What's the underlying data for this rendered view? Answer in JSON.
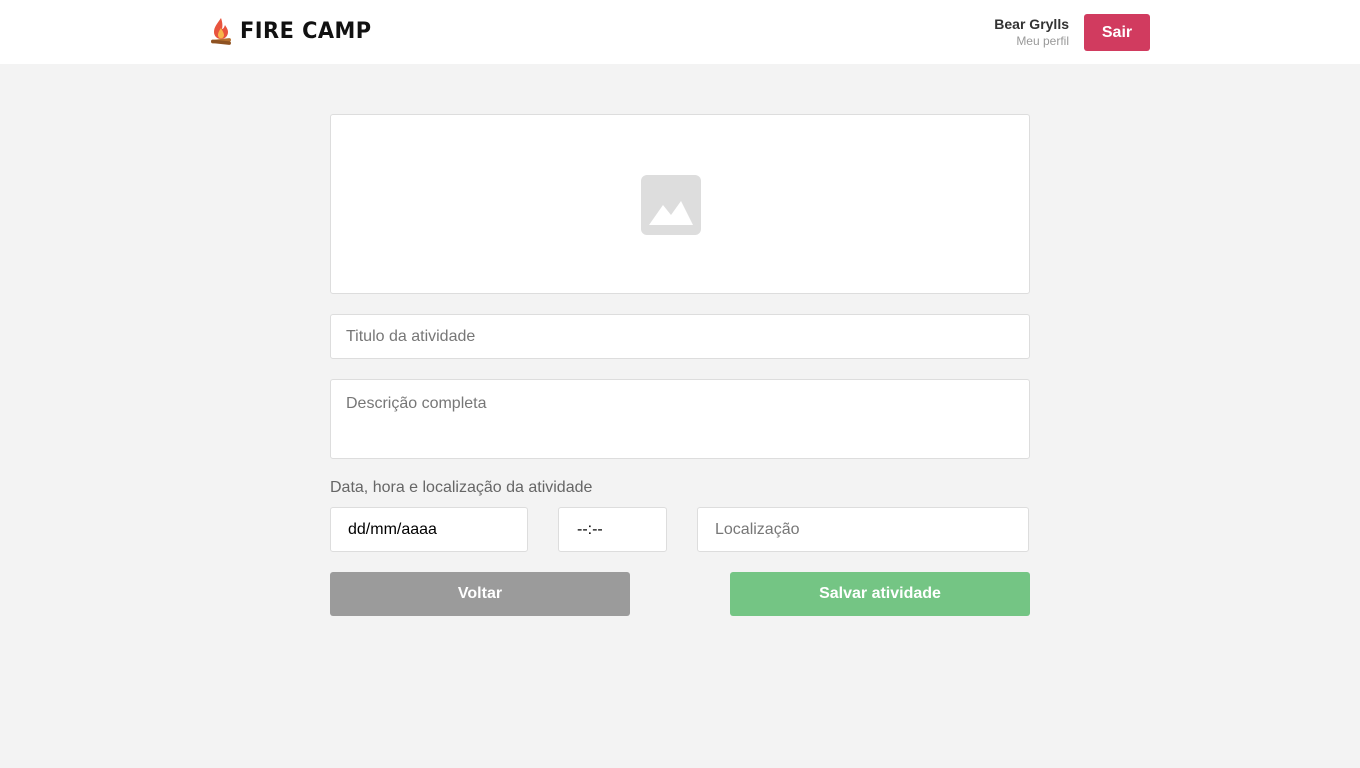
{
  "app": {
    "logo_text": "FIRE CAMP",
    "logo_icon": "campfire-icon"
  },
  "user": {
    "name": "Bear Grylls",
    "profile_link": "Meu perfil",
    "logout_label": "Sair"
  },
  "form": {
    "image_placeholder_icon": "image-icon",
    "title_placeholder": "Titulo da atividade",
    "title_value": "",
    "description_placeholder": "Descrição completa",
    "description_value": "",
    "schedule_label": "Data, hora e localização da atividade",
    "date_value": "dd/mm/aaaa",
    "time_value": "--:--",
    "location_placeholder": "Localização",
    "location_value": "",
    "back_label": "Voltar",
    "save_label": "Salvar atividade"
  },
  "colors": {
    "logout_bg": "#d13b5f",
    "back_bg": "#9b9b9b",
    "save_bg": "#74c584",
    "page_bg": "#f3f3f3"
  }
}
